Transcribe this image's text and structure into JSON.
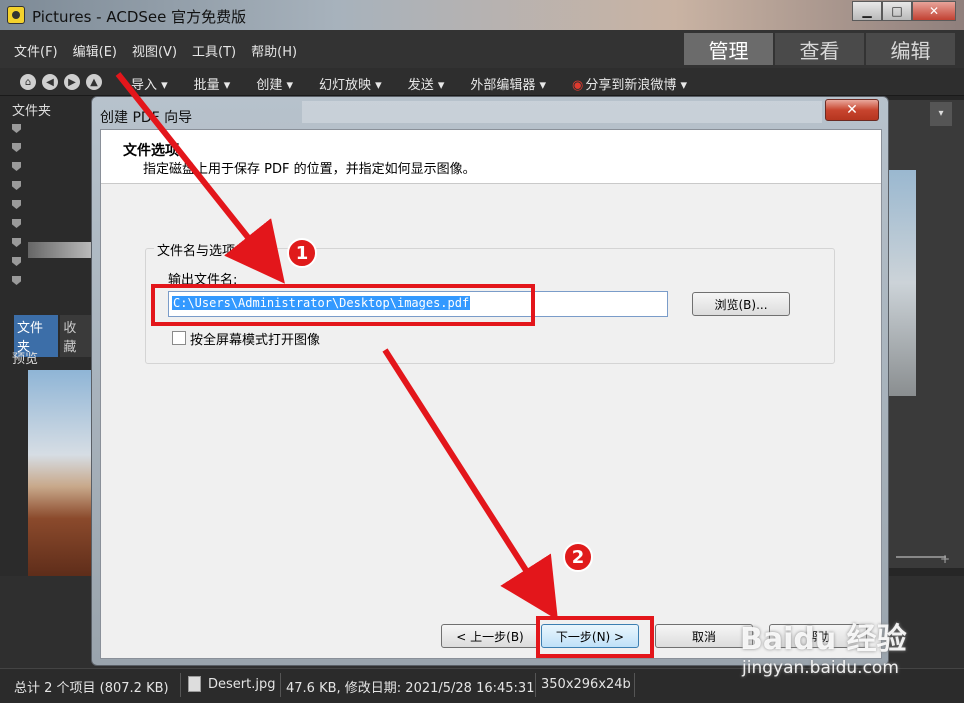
{
  "window": {
    "title": "Pictures - ACDSee 官方免费版",
    "controls": {
      "minimize": "▁",
      "maximize": "□",
      "close": "✕"
    }
  },
  "menubar": {
    "items": [
      "文件(F)",
      "编辑(E)",
      "视图(V)",
      "工具(T)",
      "帮助(H)"
    ],
    "modes": [
      "管理",
      "查看",
      "编辑"
    ],
    "active_mode": "管理"
  },
  "toolbar": {
    "nav_icons": [
      "home-icon",
      "back-icon",
      "forward-icon",
      "up-icon"
    ],
    "items": [
      "导入 ▾",
      "批量 ▾",
      "创建 ▾",
      "幻灯放映 ▾",
      "发送 ▾",
      "外部编辑器 ▾"
    ],
    "weibo_label": "分享到新浪微博",
    "weibo_dropdown": "▾"
  },
  "left_panel": {
    "folder_title": "文件夹",
    "tabs": [
      "文件夹",
      "收藏"
    ],
    "preview_title": "预览"
  },
  "right_strip": {
    "combo_arrow": "▾",
    "zoom_plus": "+"
  },
  "dialog": {
    "title": "创建 PDF 向导",
    "close": "✕",
    "header_title": "文件选项",
    "header_subtitle": "指定磁盘上用于保存 PDF 的位置，并指定如何显示图像。",
    "group_title": "文件名与选项",
    "output_label": "输出文件名:",
    "output_value": "C:\\Users\\Administrator\\Desktop\\images.pdf",
    "browse_label": "浏览(B)...",
    "fullscreen_label": "按全屏幕模式打开图像",
    "fullscreen_checked": false,
    "buttons": {
      "prev": "< 上一步(B)",
      "next": "下一步(N) >",
      "cancel": "取消",
      "help": "帮助"
    }
  },
  "annotations": {
    "step1": "1",
    "step2": "2",
    "color": "#e3161b"
  },
  "statusbar": {
    "total": "总计 2 个项目 (807.2 KB)",
    "file_name": "Desert.jpg",
    "file_info": "47.6 KB, 修改日期: 2021/5/28 16:45:31",
    "dimensions": "350x296x24b"
  },
  "watermark": {
    "brand": "Baidu 经验",
    "url": "jingyan.baidu.com"
  }
}
